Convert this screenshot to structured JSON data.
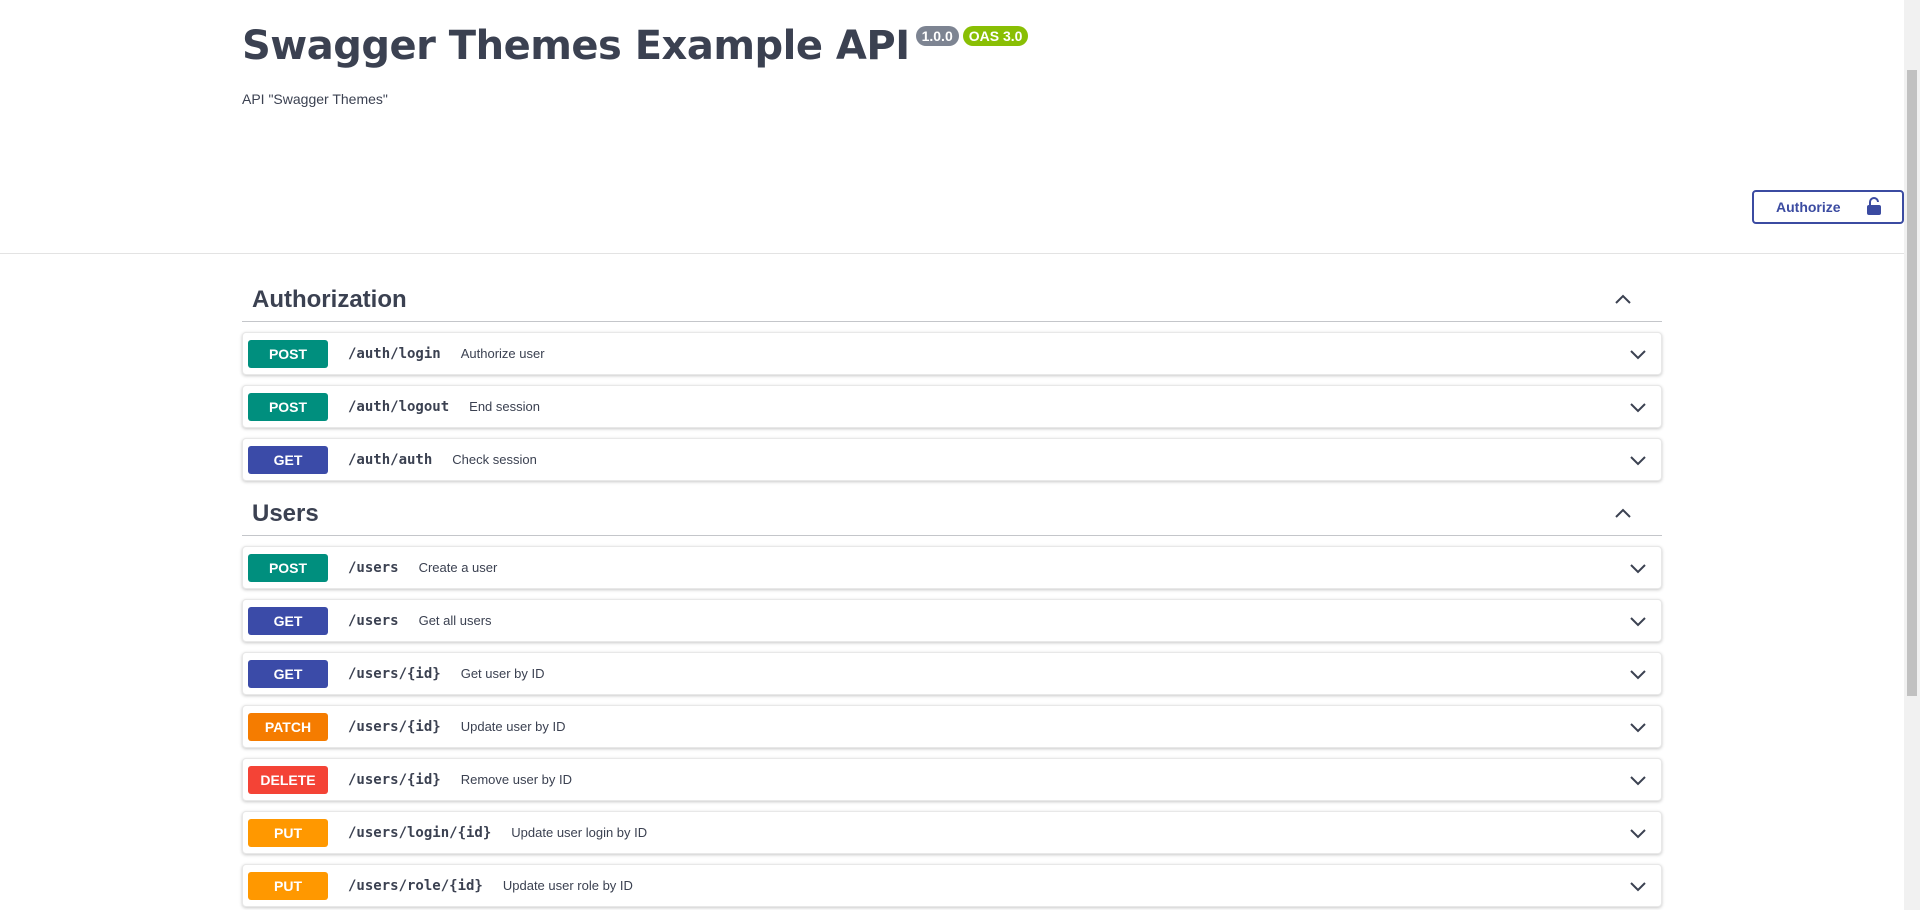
{
  "info": {
    "title": "Swagger Themes Example API",
    "version": "1.0.0",
    "oas": "OAS 3.0",
    "description": "API \"Swagger Themes\""
  },
  "authorize": {
    "label": "Authorize",
    "icon": "unlock-icon"
  },
  "colors": {
    "post": "#008f7e",
    "get": "#3b4ba8",
    "patch": "#f57c00",
    "delete": "#f44336",
    "put": "#ff9800",
    "accent": "#3b4ba1"
  },
  "tags": [
    {
      "name": "Authorization",
      "operations": [
        {
          "method": "POST",
          "path": "/auth/login",
          "summary": "Authorize user"
        },
        {
          "method": "POST",
          "path": "/auth/logout",
          "summary": "End session"
        },
        {
          "method": "GET",
          "path": "/auth/auth",
          "summary": "Check session"
        }
      ]
    },
    {
      "name": "Users",
      "operations": [
        {
          "method": "POST",
          "path": "/users",
          "summary": "Create a user"
        },
        {
          "method": "GET",
          "path": "/users",
          "summary": "Get all users"
        },
        {
          "method": "GET",
          "path": "/users/{id}",
          "summary": "Get user by ID"
        },
        {
          "method": "PATCH",
          "path": "/users/{id}",
          "summary": "Update user by ID"
        },
        {
          "method": "DELETE",
          "path": "/users/{id}",
          "summary": "Remove user by ID"
        },
        {
          "method": "PUT",
          "path": "/users/login/{id}",
          "summary": "Update user login by ID"
        },
        {
          "method": "PUT",
          "path": "/users/role/{id}",
          "summary": "Update user role by ID"
        }
      ]
    }
  ]
}
